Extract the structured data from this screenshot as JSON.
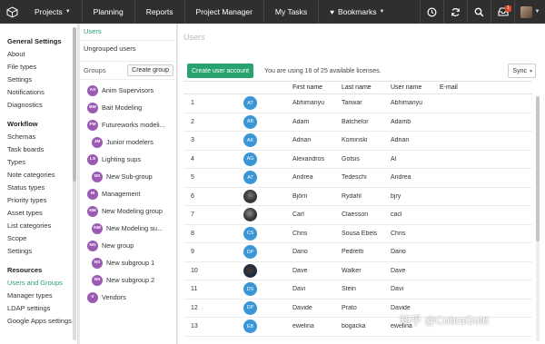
{
  "topbar": {
    "nav": [
      {
        "label": "Projects",
        "dropdown": true
      },
      {
        "label": "Planning",
        "dropdown": false
      },
      {
        "label": "Reports",
        "dropdown": false
      },
      {
        "label": "Project Manager",
        "dropdown": false
      },
      {
        "label": "My Tasks",
        "dropdown": false
      },
      {
        "label": "Bookmarks",
        "dropdown": true
      }
    ],
    "icons": [
      "logo-icon",
      "heart-icon",
      "clock-icon",
      "sync-icon",
      "search-icon",
      "inbox-icon",
      "avatar"
    ],
    "inbox_badge": "1",
    "background": "#2f2f2f"
  },
  "sidebar": {
    "sections": [
      {
        "title": "General Settings",
        "items": [
          "About",
          "File types",
          "Settings",
          "Notifications",
          "Diagnostics"
        ]
      },
      {
        "title": "Workflow",
        "items": [
          "Schemas",
          "Task boards",
          "Types",
          "Note categories",
          "Status types",
          "Priority types",
          "Asset types",
          "List categories",
          "Scope",
          "Settings"
        ]
      },
      {
        "title": "Resources",
        "items": [
          "Users and Groups",
          "Manager types",
          "LDAP settings",
          "Google Apps settings"
        ]
      }
    ],
    "active_item": "Users and Groups",
    "accent": "#2a9d6f"
  },
  "groups": {
    "users_link": "Users",
    "ungrouped": "Ungrouped users",
    "header_label": "Groups",
    "create_button": "Create group",
    "items": [
      {
        "initials": "AS",
        "name": "Anim Supervisors",
        "level": 0
      },
      {
        "initials": "BM",
        "name": "Bait Modeling",
        "level": 0
      },
      {
        "initials": "FM",
        "name": "Futureworks modeli...",
        "level": 0
      },
      {
        "initials": "JM",
        "name": "Junior modelers",
        "level": 1
      },
      {
        "initials": "LS",
        "name": "Lighting sups",
        "level": 0
      },
      {
        "initials": "NS",
        "name": "New Sub-group",
        "level": 1
      },
      {
        "initials": "M",
        "name": "Management",
        "level": 0
      },
      {
        "initials": "NM",
        "name": "New Modeling group",
        "level": 0
      },
      {
        "initials": "NM",
        "name": "New Modeling su...",
        "level": 1
      },
      {
        "initials": "NG",
        "name": "New group",
        "level": 0
      },
      {
        "initials": "NS",
        "name": "New subgroup 1",
        "level": 1
      },
      {
        "initials": "NS",
        "name": "New subgroup 2",
        "level": 1
      },
      {
        "initials": "V",
        "name": "Vendors",
        "level": 0
      }
    ],
    "badge_color": "#9c5bb3"
  },
  "main": {
    "title": "Users",
    "create_user_button": "Create user account",
    "licenses_text": "You are using 16 of 25 available licenses.",
    "sync_label": "Sync",
    "columns": [
      "First name",
      "Last name",
      "User name",
      "E-mail"
    ],
    "rows": [
      {
        "num": "1",
        "initials": "AT",
        "photo": "",
        "first": "Abhimanyu",
        "last": "Tanwar",
        "user": "Abhimanyu",
        "email": ""
      },
      {
        "num": "2",
        "initials": "AB",
        "photo": "",
        "first": "Adam",
        "last": "Batchelor",
        "user": "Adamb",
        "email": ""
      },
      {
        "num": "3",
        "initials": "AK",
        "photo": "",
        "first": "Adrian",
        "last": "Kominski",
        "user": "Adrian",
        "email": ""
      },
      {
        "num": "4",
        "initials": "AG",
        "photo": "",
        "first": "Alexandros",
        "last": "Gotsis",
        "user": "Al",
        "email": ""
      },
      {
        "num": "5",
        "initials": "AT",
        "photo": "",
        "first": "Andrea",
        "last": "Tedeschi",
        "user": "Andrea",
        "email": ""
      },
      {
        "num": "6",
        "initials": "",
        "photo": "photo",
        "first": "Björn",
        "last": "Rydahl",
        "user": "bjry",
        "email": ""
      },
      {
        "num": "7",
        "initials": "",
        "photo": "photo2",
        "first": "Carl",
        "last": "Claesson",
        "user": "cacl",
        "email": ""
      },
      {
        "num": "8",
        "initials": "CS",
        "photo": "",
        "first": "Chris",
        "last": "Sousa Ebels",
        "user": "Chris",
        "email": ""
      },
      {
        "num": "9",
        "initials": "DP",
        "photo": "",
        "first": "Dario",
        "last": "Pedretti",
        "user": "Dario",
        "email": ""
      },
      {
        "num": "10",
        "initials": "",
        "photo": "photo3",
        "first": "Dave",
        "last": "Walker",
        "user": "Dave",
        "email": ""
      },
      {
        "num": "11",
        "initials": "DS",
        "photo": "",
        "first": "Davi",
        "last": "Stein",
        "user": "Davi",
        "email": ""
      },
      {
        "num": "12",
        "initials": "DP",
        "photo": "",
        "first": "Davide",
        "last": "Prato",
        "user": "Davide",
        "email": ""
      },
      {
        "num": "13",
        "initials": "EB",
        "photo": "",
        "first": "ewelina",
        "last": "bogacka",
        "user": "ewelina",
        "email": ""
      }
    ],
    "accent": "#27a36f",
    "avatar_color": "#3a96d6"
  },
  "watermark": "知乎 @CobraGold"
}
